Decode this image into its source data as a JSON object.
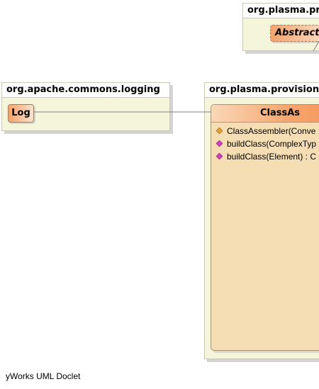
{
  "packages": {
    "top": {
      "name": "org.plasma.pro",
      "class_name": "AbstractA"
    },
    "logging": {
      "name": "org.apache.commons.logging",
      "class_name": "Log"
    },
    "provisioning": {
      "name": "org.plasma.provisionin",
      "class_name": "ClassAs",
      "members": [
        {
          "label": "ClassAssembler(Conve",
          "kind": "constructor"
        },
        {
          "label": "buildClass(ComplexTyp",
          "kind": "method"
        },
        {
          "label": "buildClass(Element) : C",
          "kind": "method"
        }
      ]
    }
  },
  "footer": "yWorks UML Doclet",
  "colors": {
    "package_fill": "#f5f5dc",
    "class_fill": "#f5deb3",
    "class_header": "#f6a36a",
    "constructor_icon": "#e6a030",
    "method_icon": "#d040c0"
  }
}
